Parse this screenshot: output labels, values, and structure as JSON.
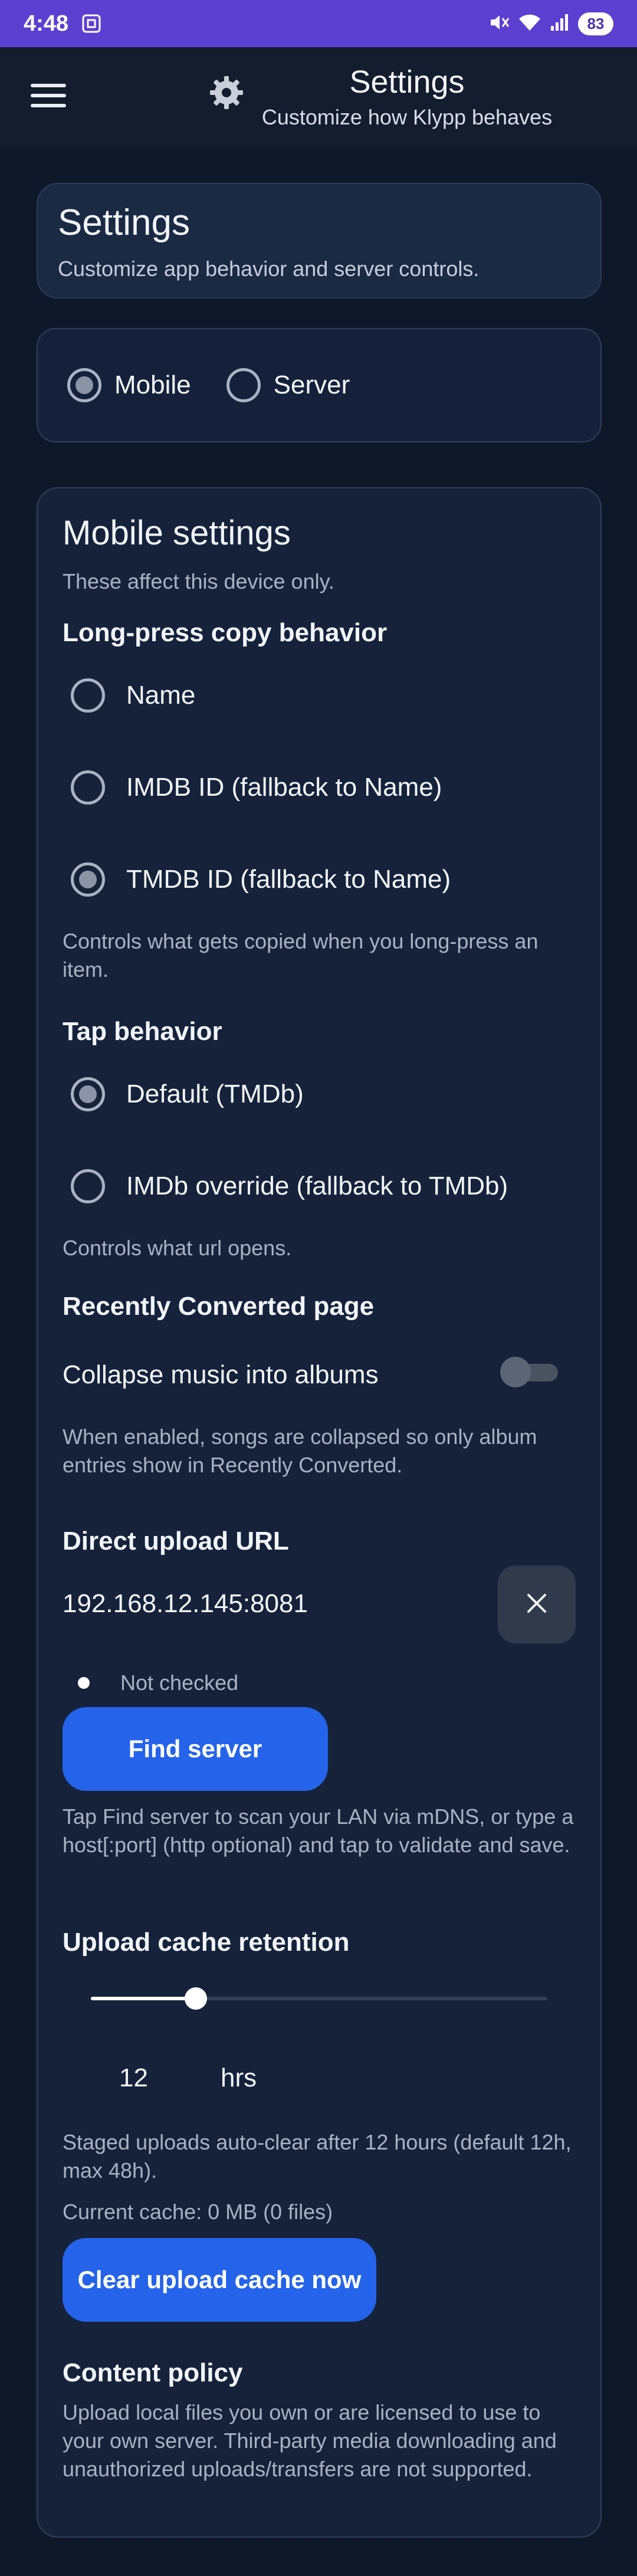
{
  "status_bar": {
    "time": "4:48",
    "battery": "83"
  },
  "app_bar": {
    "title": "Settings",
    "subtitle": "Customize how Klypp behaves"
  },
  "header_card": {
    "title": "Settings",
    "subtitle": "Customize app behavior and server controls."
  },
  "mode": {
    "options": [
      "Mobile",
      "Server"
    ],
    "selected": "Mobile"
  },
  "mobile": {
    "title": "Mobile settings",
    "subtitle": "These affect this device only.",
    "long_press": {
      "heading": "Long-press copy behavior",
      "options": [
        "Name",
        "IMDB ID (fallback to Name)",
        "TMDB ID (fallback to Name)"
      ],
      "selected_index": 2,
      "help": "Controls what gets copied when you long-press an item."
    },
    "tap": {
      "heading": "Tap behavior",
      "options": [
        "Default (TMDb)",
        "IMDb override (fallback to TMDb)"
      ],
      "selected_index": 0,
      "help": "Controls what url opens."
    },
    "recent": {
      "heading": "Recently Converted page",
      "toggle_label": "Collapse music into albums",
      "toggle_on": false,
      "help": "When enabled, songs are collapsed so only album entries show in Recently Converted."
    },
    "upload": {
      "heading": "Direct upload URL",
      "value": "192.168.12.145:8081",
      "status": "Not checked",
      "find_button": "Find server",
      "help": "Tap Find server to scan your LAN via mDNS, or type a host[:port] (http optional) and tap to validate and save."
    },
    "cache": {
      "heading": "Upload cache retention",
      "value": "12",
      "unit": "hrs",
      "slider_fraction": 0.23,
      "help": "Staged uploads auto-clear after 12 hours (default 12h, max 48h).",
      "current": "Current cache: 0 MB (0 files)",
      "clear_button": "Clear upload cache now"
    },
    "policy": {
      "heading": "Content policy",
      "text": "Upload local files you own or are licensed to use to your own server. Third-party media downloading and unauthorized uploads/transfers are not supported."
    }
  },
  "colors": {
    "accent": "#2563eb",
    "status_bar": "#5b3fd1",
    "background": "#0f1829",
    "card": "#16223a"
  }
}
